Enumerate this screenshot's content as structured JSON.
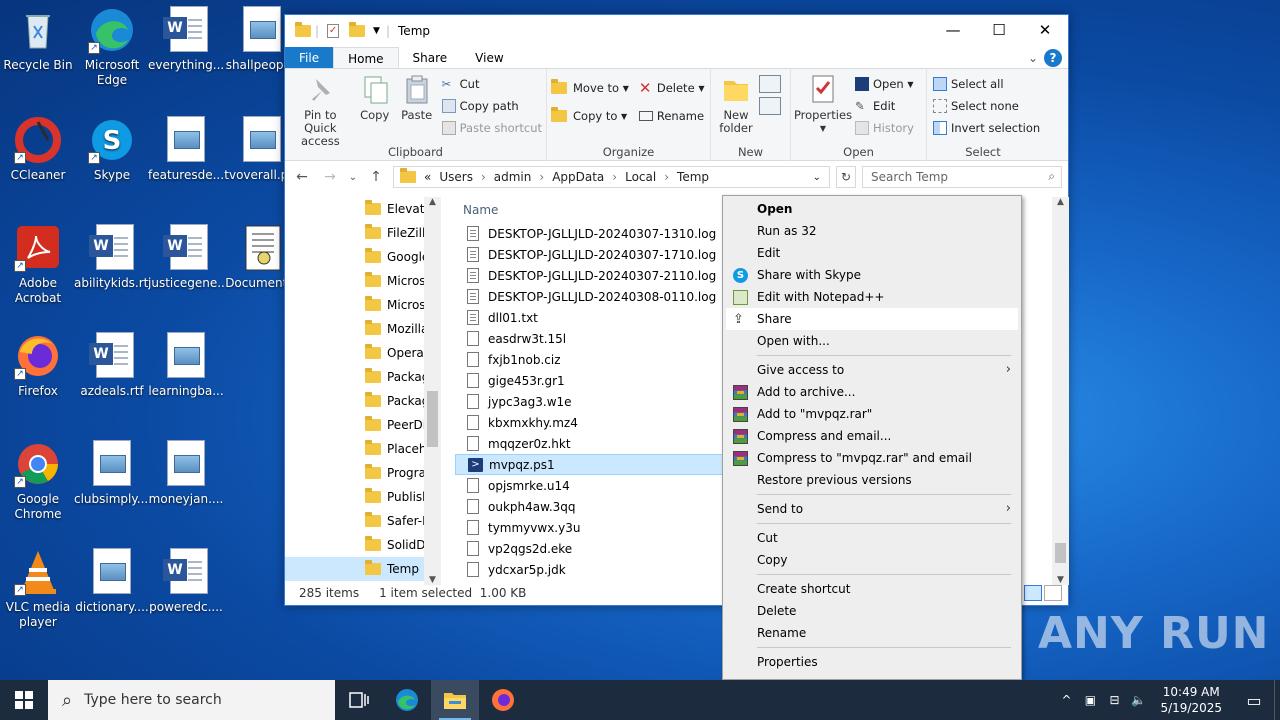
{
  "desktop": {
    "icons": [
      {
        "label": "Recycle Bin"
      },
      {
        "label": "Microsoft Edge"
      },
      {
        "label": "everything...."
      },
      {
        "label": "shallpeopl..."
      },
      {
        "label": "CCleaner"
      },
      {
        "label": "Skype"
      },
      {
        "label": "featuresde..."
      },
      {
        "label": "tvoverall.p..."
      },
      {
        "label": "Adobe Acrobat"
      },
      {
        "label": "abilitykids.rtf"
      },
      {
        "label": "justicegene..."
      },
      {
        "label": "Document..."
      },
      {
        "label": "Firefox"
      },
      {
        "label": "azdeals.rtf"
      },
      {
        "label": "learningba..."
      },
      {
        "label": "Google Chrome"
      },
      {
        "label": "clubsimply...."
      },
      {
        "label": "moneyjan...."
      },
      {
        "label": "VLC media player"
      },
      {
        "label": "dictionary...."
      },
      {
        "label": "poweredc...."
      }
    ]
  },
  "explorer": {
    "title": "Temp",
    "tabs": [
      "File",
      "Home",
      "Share",
      "View"
    ],
    "ribbon": {
      "clipboard": {
        "label": "Clipboard",
        "pin": "Pin to Quick access",
        "copy": "Copy",
        "paste": "Paste",
        "cut": "Cut",
        "copy_path": "Copy path",
        "paste_shortcut": "Paste shortcut"
      },
      "organize": {
        "label": "Organize",
        "move_to": "Move to",
        "copy_to": "Copy to",
        "delete": "Delete",
        "rename": "Rename"
      },
      "new": {
        "label": "New",
        "new_folder": "New folder"
      },
      "open": {
        "label": "Open",
        "properties": "Properties",
        "open": "Open",
        "edit": "Edit",
        "history": "History"
      },
      "select": {
        "label": "Select",
        "select_all": "Select all",
        "select_none": "Select none",
        "invert": "Invert selection"
      }
    },
    "address": {
      "prefix": "«",
      "crumbs": [
        "Users",
        "admin",
        "AppData",
        "Local",
        "Temp"
      ],
      "search_placeholder": "Search Temp"
    },
    "nav_items": [
      "Elevate",
      "FileZilla",
      "Google",
      "Microso",
      "Microso",
      "Mozilla",
      "Opera",
      "Packag",
      "Packag",
      "PeerDis",
      "Placeho",
      "Progran",
      "Publish",
      "Safer-N",
      "SolidDo",
      "Temp"
    ],
    "column_name": "Name",
    "files": [
      {
        "name": "DESKTOP-JGLLJLD-20240307-1310.log",
        "type": "txt"
      },
      {
        "name": "DESKTOP-JGLLJLD-20240307-1710.log",
        "type": "txt"
      },
      {
        "name": "DESKTOP-JGLLJLD-20240307-2110.log",
        "type": "txt"
      },
      {
        "name": "DESKTOP-JGLLJLD-20240308-0110.log",
        "type": "txt"
      },
      {
        "name": "dll01.txt",
        "type": "txt"
      },
      {
        "name": "easdrw3t.15l",
        "type": "blank"
      },
      {
        "name": "fxjb1nob.ciz",
        "type": "blank"
      },
      {
        "name": "gige453r.gr1",
        "type": "blank"
      },
      {
        "name": "jypc3ag3.w1e",
        "type": "blank"
      },
      {
        "name": "kbxmxkhy.mz4",
        "type": "blank"
      },
      {
        "name": "mqqzer0z.hkt",
        "type": "blank"
      },
      {
        "name": "mvpqz.ps1",
        "type": "ps1"
      },
      {
        "name": "opjsmrke.u14",
        "type": "blank"
      },
      {
        "name": "oukph4aw.3qq",
        "type": "blank"
      },
      {
        "name": "tymmyvwx.y3u",
        "type": "blank"
      },
      {
        "name": "vp2qgs2d.eke",
        "type": "blank"
      },
      {
        "name": "ydcxar5p.jdk",
        "type": "blank"
      }
    ],
    "status": {
      "count": "285 items",
      "selected": "1 item selected",
      "size": "1.00 KB"
    }
  },
  "context_menu": {
    "open": "Open",
    "run_as_32": "Run as 32",
    "edit": "Edit",
    "share_skype": "Share with Skype",
    "edit_notepad": "Edit with Notepad++",
    "share": "Share",
    "open_with": "Open with...",
    "give_access": "Give access to",
    "add_archive": "Add to archive...",
    "add_rar": "Add to \"mvpqz.rar\"",
    "compress_email": "Compress and email...",
    "compress_rar_email": "Compress to \"mvpqz.rar\" and email",
    "restore": "Restore previous versions",
    "send_to": "Send to",
    "cut": "Cut",
    "copy": "Copy",
    "create_shortcut": "Create shortcut",
    "delete": "Delete",
    "rename": "Rename",
    "properties": "Properties"
  },
  "taskbar": {
    "search_placeholder": "Type here to search",
    "time": "10:49 AM",
    "date": "5/19/2025"
  },
  "watermark": "ANY RUN"
}
